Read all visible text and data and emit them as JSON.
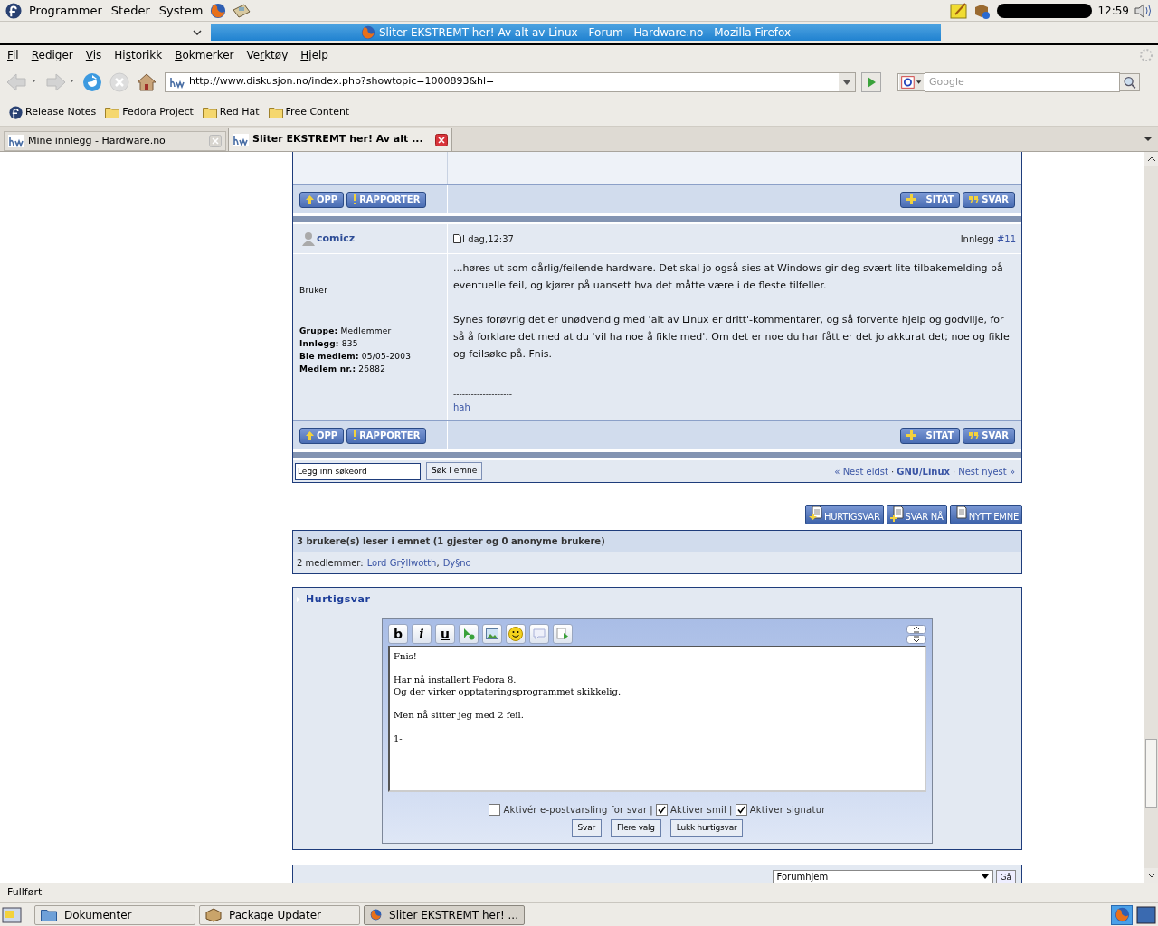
{
  "top_panel": {
    "menus": [
      "Programmer",
      "Steder",
      "System"
    ],
    "clock": "12:59"
  },
  "window": {
    "title": "Sliter EKSTREMT her! Av alt av Linux - Forum - Hardware.no - Mozilla Firefox"
  },
  "menubar": [
    {
      "key": "F",
      "post": "il"
    },
    {
      "key": "R",
      "post": "ediger"
    },
    {
      "key": "V",
      "post": "is"
    },
    {
      "pre": "Hi",
      "key": "s",
      "post": "torikk"
    },
    {
      "key": "B",
      "post": "okmerker"
    },
    {
      "pre": "Ve",
      "key": "r",
      "post": "ktøy"
    },
    {
      "key": "H",
      "post": "jelp"
    }
  ],
  "navigation": {
    "url": "http://www.diskusjon.no/index.php?showtopic=1000893&hl=",
    "search_placeholder": "Google"
  },
  "bookmarks": [
    {
      "label": "Release Notes",
      "kind": "fedora"
    },
    {
      "label": "Fedora Project",
      "kind": "folder"
    },
    {
      "label": "Red Hat",
      "kind": "folder"
    },
    {
      "label": "Free Content",
      "kind": "folder"
    }
  ],
  "tabs": [
    {
      "label": "Mine innlegg - Hardware.no",
      "selected": false
    },
    {
      "label": "Sliter EKSTREMT her! Av alt ...",
      "selected": true
    }
  ],
  "button_rows": [
    {
      "left": [
        {
          "label": "OPP",
          "kind": "up"
        },
        {
          "label": "RAPPORTER",
          "kind": "report"
        }
      ],
      "right": [
        {
          "label": "SITAT",
          "kind": "plus"
        },
        {
          "label": "SVAR",
          "kind": "quote"
        }
      ]
    },
    {
      "left": [
        {
          "label": "OPP",
          "kind": "up"
        },
        {
          "label": "RAPPORTER",
          "kind": "report"
        }
      ],
      "right": [
        {
          "label": "SITAT",
          "kind": "plus"
        },
        {
          "label": "SVAR",
          "kind": "quote"
        }
      ]
    }
  ],
  "post": {
    "author": "comicz",
    "date": "I dag,12:37",
    "post_label": "Innlegg",
    "post_number": "#11",
    "rank": "Bruker",
    "fields": [
      {
        "label": "Gruppe:",
        "value": "Medlemmer"
      },
      {
        "label": "Innlegg:",
        "value": "835"
      },
      {
        "label": "Ble medlem:",
        "value": "05/05-2003"
      },
      {
        "label": "Medlem nr.:",
        "value": "26882"
      }
    ],
    "paragraphs": [
      "...høres ut som dårlig/feilende hardware. Det skal jo også sies at Windows gir deg svært lite tilbakemelding på eventuelle feil, og kjører på uansett hva det måtte være i de fleste tilfeller.",
      "Synes forøvrig det er unødvendig med 'alt av Linux er dritt'-kommentarer, og så forvente hjelp og godvilje, for så å forklare det med at du 'vil ha noe å fikle med'. Om det er noe du har fått er det jo akkurat det; noe og fikle og feilsøke på. Fnis."
    ],
    "signature_rule": "--------------------",
    "signature": "hah"
  },
  "topic_search": {
    "value": "Legg inn søkeord",
    "button": "Søk i emne"
  },
  "topic_nav": [
    {
      "text": "« Nest eldst",
      "kind": "link"
    },
    {
      "text": "·",
      "kind": "sep"
    },
    {
      "text": "GNU/Linux",
      "kind": "forum"
    },
    {
      "text": "·",
      "kind": "sep"
    },
    {
      "text": "Nest nyest »",
      "kind": "link"
    }
  ],
  "actions": [
    {
      "label": "HURTIGSVAR",
      "kind": "quick"
    },
    {
      "label": "SVAR NÅ",
      "kind": "reply"
    },
    {
      "label": "NYTT EMNE",
      "kind": "new"
    }
  ],
  "online": {
    "header": "3 brukere(s) leser i emnet (1 gjester og 0 anonyme brukere)",
    "members_label": "2 medlemmer:",
    "members": [
      "Lord Grÿllwotth",
      "Dy§no"
    ],
    "separator": ","
  },
  "quick_reply": {
    "title": "Hurtigsvar",
    "tools": [
      {
        "kind": "bold",
        "label": "b"
      },
      {
        "kind": "italic",
        "label": "i"
      },
      {
        "kind": "underline",
        "label": "u"
      },
      {
        "kind": "link"
      },
      {
        "kind": "image"
      },
      {
        "kind": "smiley"
      },
      {
        "kind": "speech"
      },
      {
        "kind": "code"
      }
    ],
    "text": "Fnis!\n\nHar nå installert Fedora 8.\nOg der virker opptateringsprogrammet skikkelig.\n\nMen nå sitter jeg med 2 feil.\n\n1-",
    "options": [
      {
        "label": "Aktivér e-postvarsling for svar",
        "checked": false,
        "separator": "|"
      },
      {
        "label": "Aktiver smil",
        "checked": true,
        "separator": "|"
      },
      {
        "label": "Aktiver signatur",
        "checked": true
      }
    ],
    "buttons": [
      "Svar",
      "Flere valg",
      "Lukk hurtigsvar"
    ]
  },
  "jump": {
    "select": "Forumhjem",
    "button": "Gå"
  },
  "status_bar": "Fullført",
  "taskbar": [
    {
      "label": "Dokumenter",
      "kind": "folder",
      "selected": false
    },
    {
      "label": "Package Updater",
      "kind": "package",
      "selected": false
    },
    {
      "label": "Sliter EKSTREMT her! ...",
      "kind": "firefox",
      "selected": true
    }
  ]
}
